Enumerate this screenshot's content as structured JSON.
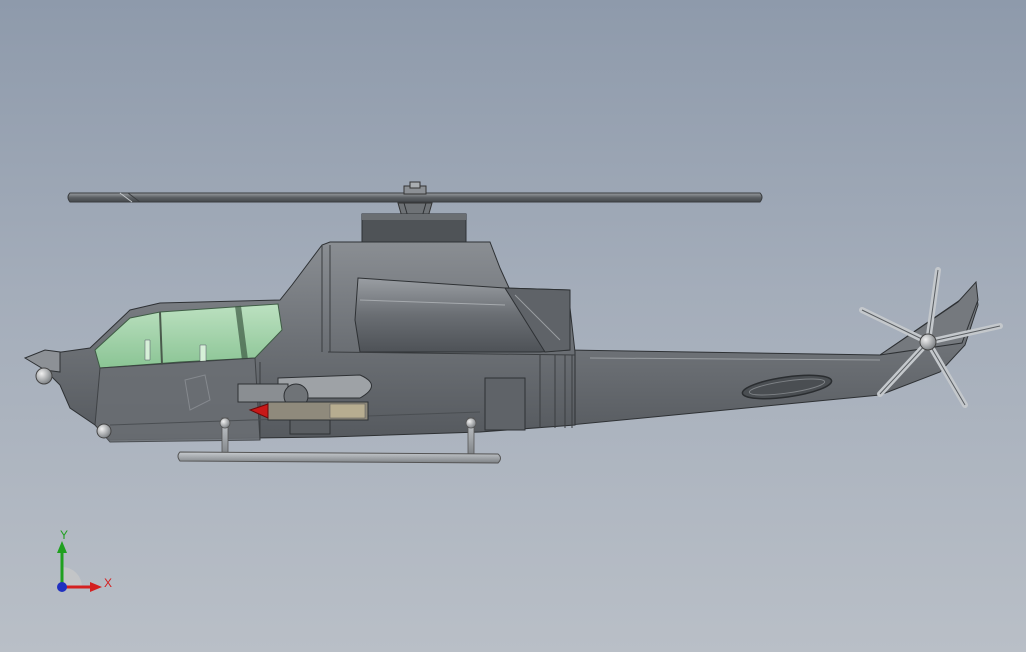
{
  "viewport": {
    "background_top": "#8e9aab",
    "background_bottom": "#b9bfc7"
  },
  "model": {
    "subject": "helicopter-side-view",
    "body_color": "#6f7377",
    "glass_color": "#9fd9a8",
    "rocket_tip_color": "#c81818"
  },
  "triad": {
    "x_label": "X",
    "y_label": "Y",
    "x_color": "#d42020",
    "y_color": "#20a020",
    "z_color": "#2030c0"
  }
}
